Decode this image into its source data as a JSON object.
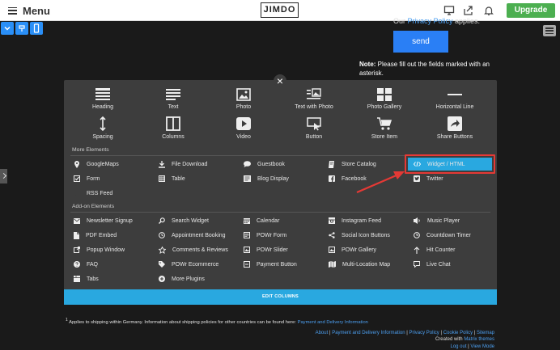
{
  "topbar": {
    "menu_label": "Menu",
    "logo": "JIMDO",
    "upgrade_label": "Upgrade"
  },
  "page": {
    "policy_prefix": "Our ",
    "policy_link": "Privacy Policy",
    "policy_suffix": " applies.",
    "send_label": "send",
    "note_label": "Note:",
    "note_text": " Please fill out the fields marked with an asterisk."
  },
  "modal": {
    "close": "×",
    "basic_elements": [
      {
        "label": "Heading",
        "icon": "heading-icon"
      },
      {
        "label": "Text",
        "icon": "text-icon"
      },
      {
        "label": "Photo",
        "icon": "photo-icon"
      },
      {
        "label": "Text with Photo",
        "icon": "text-with-photo-icon"
      },
      {
        "label": "Photo Gallery",
        "icon": "photo-gallery-icon"
      },
      {
        "label": "Horizontal Line",
        "icon": "horizontal-line-icon"
      },
      {
        "label": "Spacing",
        "icon": "spacing-icon"
      },
      {
        "label": "Columns",
        "icon": "columns-icon"
      },
      {
        "label": "Video",
        "icon": "video-icon"
      },
      {
        "label": "Button",
        "icon": "button-icon"
      },
      {
        "label": "Store Item",
        "icon": "store-item-icon"
      },
      {
        "label": "Share Buttons",
        "icon": "share-buttons-icon"
      }
    ],
    "more_elements_title": "More Elements",
    "more_elements": [
      {
        "label": "GoogleMaps",
        "icon": "map-pin-icon"
      },
      {
        "label": "File Download",
        "icon": "download-icon"
      },
      {
        "label": "Guestbook",
        "icon": "speech-bubble-icon"
      },
      {
        "label": "Store Catalog",
        "icon": "catalog-icon"
      },
      {
        "label": "Widget / HTML",
        "icon": "code-icon"
      },
      {
        "label": "Form",
        "icon": "form-check-icon"
      },
      {
        "label": "Table",
        "icon": "table-icon"
      },
      {
        "label": "Blog Display",
        "icon": "blog-icon"
      },
      {
        "label": "Facebook",
        "icon": "facebook-icon"
      },
      {
        "label": "Twitter",
        "icon": "twitter-icon"
      },
      {
        "label": "RSS Feed",
        "icon": "rss-icon"
      }
    ],
    "addon_title": "Add-on Elements",
    "addon_elements": [
      {
        "label": "Newsletter Signup",
        "icon": "envelope-icon"
      },
      {
        "label": "Search Widget",
        "icon": "search-icon"
      },
      {
        "label": "Calendar",
        "icon": "calendar-icon"
      },
      {
        "label": "Instagram Feed",
        "icon": "instagram-icon"
      },
      {
        "label": "Music Player",
        "icon": "music-icon"
      },
      {
        "label": "PDF Embed",
        "icon": "pdf-icon"
      },
      {
        "label": "Appointment Booking",
        "icon": "clock-icon"
      },
      {
        "label": "POWr Form",
        "icon": "powr-form-icon"
      },
      {
        "label": "Social Icon Buttons",
        "icon": "share-icon"
      },
      {
        "label": "Countdown Timer",
        "icon": "timer-icon"
      },
      {
        "label": "Popup Window",
        "icon": "popup-icon"
      },
      {
        "label": "Comments & Reviews",
        "icon": "star-icon"
      },
      {
        "label": "POWr Slider",
        "icon": "slider-icon"
      },
      {
        "label": "POWr Gallery",
        "icon": "gallery-icon"
      },
      {
        "label": "Hit Counter",
        "icon": "arrow-up-icon"
      },
      {
        "label": "FAQ",
        "icon": "question-icon"
      },
      {
        "label": "POWr Ecommerce",
        "icon": "tag-icon"
      },
      {
        "label": "Payment Button",
        "icon": "payment-icon"
      },
      {
        "label": "Multi-Location Map",
        "icon": "map-icon"
      },
      {
        "label": "Live Chat",
        "icon": "chat-icon"
      },
      {
        "label": "Tabs",
        "icon": "tabs-icon"
      },
      {
        "label": "More Plugins",
        "icon": "plus-circle-icon"
      }
    ],
    "edit_columns_label": "EDIT COLUMNS"
  },
  "footer": {
    "sup": "1",
    "shipping_text": " Applies to shipping within Germany. Information about shipping policies for other countries can be found here: ",
    "shipping_link": "Payment and Delivery Information",
    "links": [
      "About",
      "Payment and Delivery Information",
      "Privacy Policy",
      "Cookie Policy",
      "Sitemap"
    ],
    "created_prefix": "Created with ",
    "created_link": "Matrix themes",
    "logout": "Log out",
    "view_mode": "View Mode"
  },
  "colors": {
    "accent": "#29a8e0",
    "upgrade": "#4caf50",
    "highlight": "#e53935",
    "modal_bg": "#3d3d3d"
  }
}
